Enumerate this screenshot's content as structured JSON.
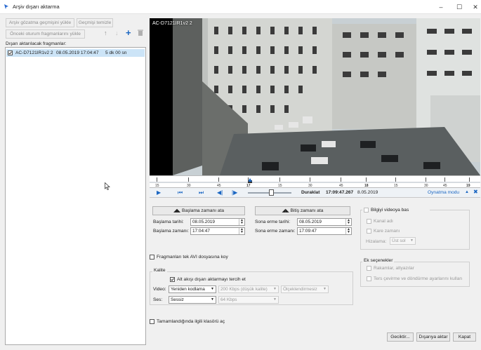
{
  "window": {
    "title": "Arşiv dışarı aktarma",
    "minimize": "–",
    "maximize": "☐",
    "close": "✕"
  },
  "toolbar": {
    "load_history": "Arşiv gözatma geçmişini yükle",
    "clear_history": "Geçmişi temizle",
    "load_prev_session": "Önceki oturum fragmanlarını yükle"
  },
  "list": {
    "header": "Dışarı aktarılacak fragmanlar:",
    "items": [
      {
        "camera": "AC-D7121IR1v2 2",
        "date": "08.05.2019 17:04:47",
        "duration": "5 dk 00 sn",
        "checked": true
      }
    ]
  },
  "video": {
    "overlay": "AC-D7121IR1v2 2"
  },
  "timeline": {
    "ticks": [
      "15",
      "30",
      "45",
      "17",
      "15",
      "30",
      "45",
      "18",
      "15",
      "30",
      "45",
      "19"
    ],
    "status": "Duraklat",
    "time": "17:09:47.267",
    "date": "8.05.2019",
    "mode": "Oynatma modu"
  },
  "range": {
    "set_start": "Başlama zamanı ata",
    "set_end": "Bitiş zamanı ata",
    "start_date_label": "Başlama tarihi:",
    "start_date": "08.05.2019",
    "start_time_label": "Başlama zamanı:",
    "start_time": "17:04:47",
    "end_date_label": "Sona erme tarihi:",
    "end_date": "08.05.2019",
    "end_time_label": "Sona erme zamanı:",
    "end_time": "17:09:47"
  },
  "info": {
    "show_info": "Bilgiyi videoya bas",
    "channel_name": "Kanal adı",
    "frame_time": "Kare zamanı",
    "align_label": "Hizalama:",
    "align_value": "Üst sol"
  },
  "single_avi": "Fragmanları tek AVI dosyasına koy",
  "extra": {
    "title": "Ek seçenekler",
    "digits": "Rakamlar, altyazılar",
    "rotate": "Ters çevirme ve döndürme ayarlarını kullan"
  },
  "quality": {
    "title": "Kalite",
    "prefer_sub": "Alt akışı dışarı aktarmayı tercih et",
    "video_label": "Video:",
    "video_mode": "Yeniden kodlama",
    "bitrate": "200 Kbps (düşük kalite)",
    "scale": "Ölçeklendirmesiz",
    "audio_label": "Ses:",
    "audio_mode": "Sessiz",
    "audio_bitrate": "64 Kbps"
  },
  "open_folder": "Tamamlandığında ilgili klasörü aç",
  "footer": {
    "delay": "Geciktir...",
    "export": "Dışarıya aktar",
    "close": "Kapat"
  },
  "colors": {
    "accent": "#1a66c2",
    "selection": "#cce4f7"
  }
}
